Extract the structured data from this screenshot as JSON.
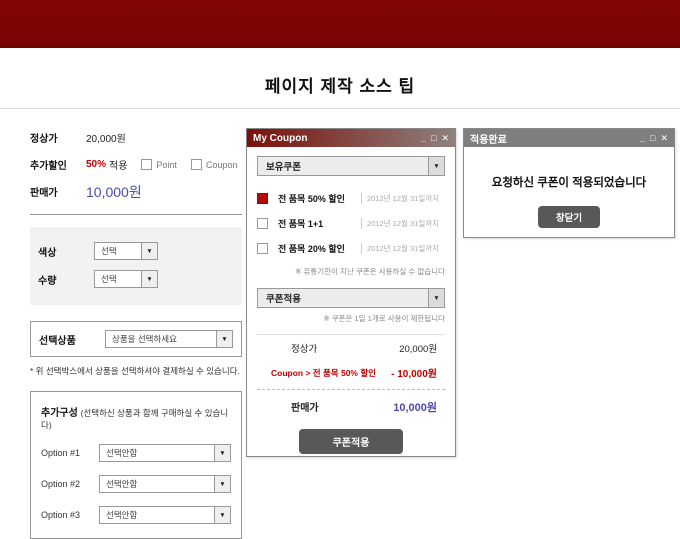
{
  "page": {
    "title": "페이지 제작 소스 팁"
  },
  "colors": {
    "banner_red": "#7d0505",
    "accent_red": "#c00000",
    "checked_box_red": "#b00c0c",
    "price_blue": "#4b4baa",
    "mycoupon_titlebar": "#7a100a",
    "applied_titlebar": "#7f7f7f",
    "button_gray": "#585858"
  },
  "left_panel": {
    "normal_price_label": "정상가",
    "normal_price_value": "20,000원",
    "discount_label": "추가할인",
    "discount_percent": "50%",
    "discount_suffix": "적용",
    "point_checkbox_label": "Point",
    "coupon_checkbox_label": "Coupon",
    "sale_price_label": "판매가",
    "sale_price_value": "10,000원",
    "color_label": "색상",
    "color_value": "선택",
    "qty_label": "수량",
    "qty_value": "선택",
    "select_product_label": "선택상품",
    "select_product_value": "상품을 선택하세요",
    "select_product_note": "* 위 선택박스에서 상품을 선택하셔야 결제하실 수 있습니다.",
    "extra_title": "추가구성",
    "extra_subtitle": "(선택하신 상품과 함께 구매하실 수 있습니다)",
    "extra_options": [
      {
        "label": "Option #1",
        "value": "선택안함"
      },
      {
        "label": "Option #2",
        "value": "선택안함"
      },
      {
        "label": "Option #3",
        "value": "선택안함"
      }
    ]
  },
  "my_coupon": {
    "window_title": "My Coupon",
    "controls": {
      "minimize": "_",
      "maximize": "□",
      "close": "✕"
    },
    "owned_header": "보유쿠폰",
    "coupons": [
      {
        "name": "전 품목 50% 할인",
        "expiry": "2012년 12월 31일까지",
        "checked": true
      },
      {
        "name": "전 품목 1+1",
        "expiry": "2012년 12월 31일까지",
        "checked": false
      },
      {
        "name": "전 품목 20% 할인",
        "expiry": "2012년 12월 31일까지",
        "checked": false
      }
    ],
    "expiry_note": "※ 유통기한이 지난 쿠폰은 사용하실 수 없습니다",
    "apply_header": "쿠폰적용",
    "limit_note": "※ 쿠폰은 1일 1개로 사용이 제한됩니다",
    "summary": {
      "normal_label": "정상가",
      "normal_value": "20,000원",
      "coupon_label": "Coupon > 전 품목 50% 할인",
      "coupon_value": "- 10,000원",
      "sale_label": "판매가",
      "sale_value": "10,000원"
    },
    "apply_button": "쿠폰적용"
  },
  "applied_window": {
    "window_title": "적용완료",
    "controls": {
      "minimize": "_",
      "maximize": "□",
      "close": "✕"
    },
    "message": "요청하신 쿠폰이 적용되었습니다",
    "close_button": "창닫기"
  }
}
